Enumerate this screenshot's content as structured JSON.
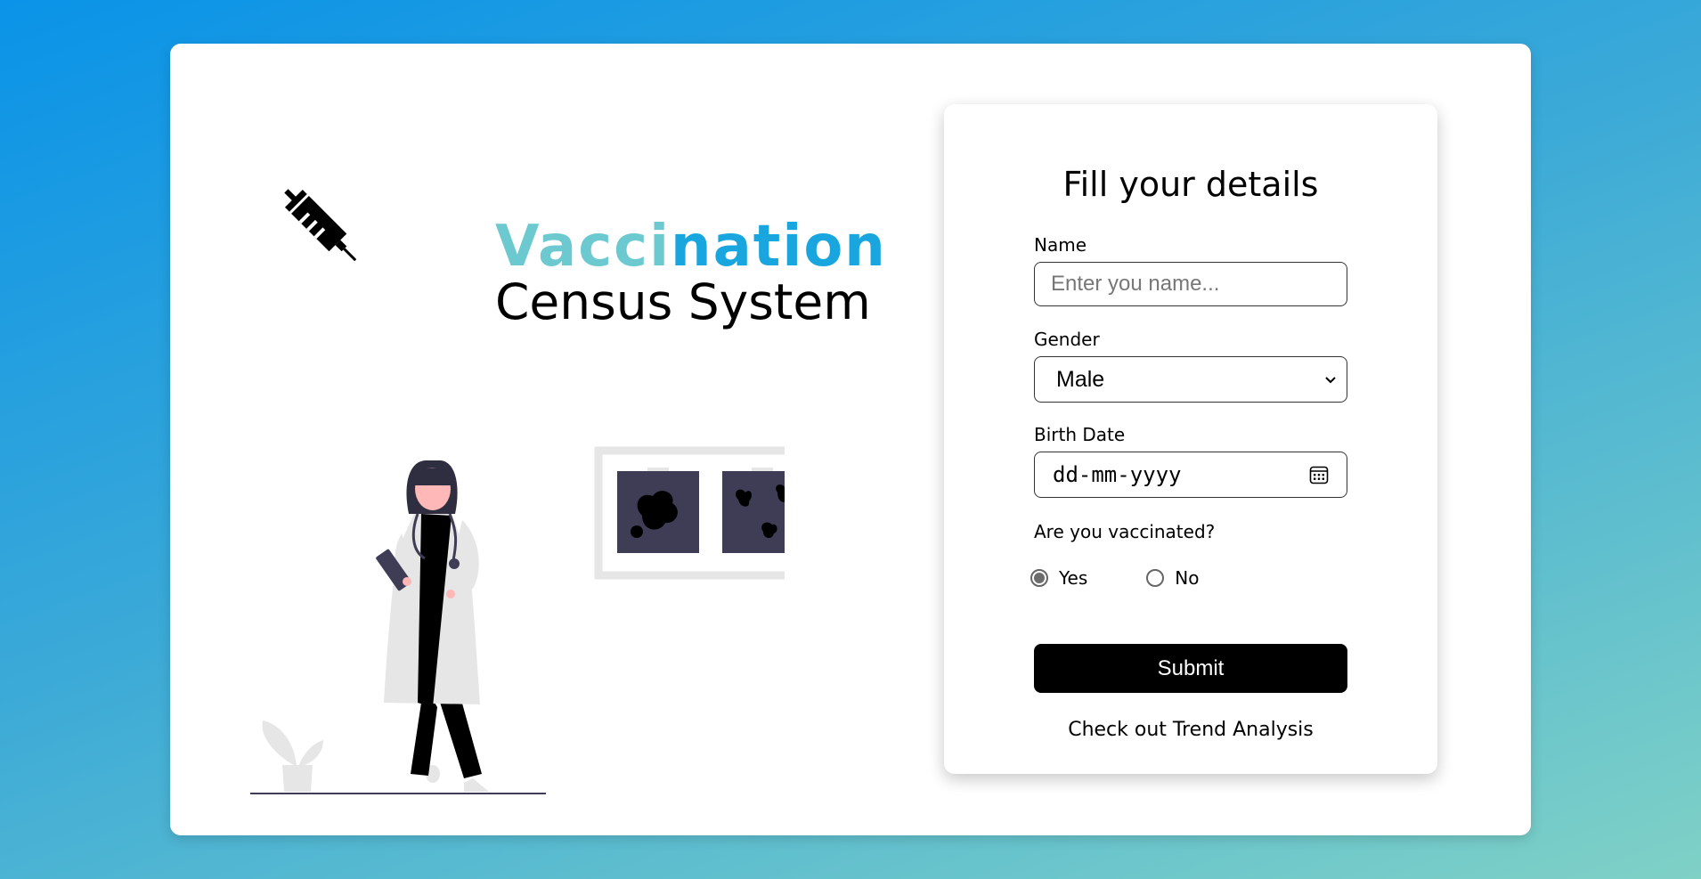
{
  "brand": {
    "title_part1": "Vacci",
    "title_part2": "nation",
    "subtitle": "Census System"
  },
  "icons": {
    "brand": "syringe-icon",
    "illustration": "doctor-illustration"
  },
  "form": {
    "title": "Fill your details",
    "name": {
      "label": "Name",
      "placeholder": "Enter you name...",
      "value": ""
    },
    "gender": {
      "label": "Gender",
      "selected": "Male"
    },
    "birth_date": {
      "label": "Birth Date",
      "value": "dd-mm-yyyy"
    },
    "vaccinated": {
      "label": "Are you vaccinated?",
      "options": [
        {
          "label": "Yes",
          "checked": true
        },
        {
          "label": "No",
          "checked": false
        }
      ]
    },
    "submit_label": "Submit",
    "trend_link": "Check out Trend Analysis"
  },
  "colors": {
    "brand_light": "#6bc9cf",
    "brand_blue": "#19a6df",
    "button": "#000000",
    "background_start": "#0a93e8",
    "background_end": "#7fd1c6"
  }
}
